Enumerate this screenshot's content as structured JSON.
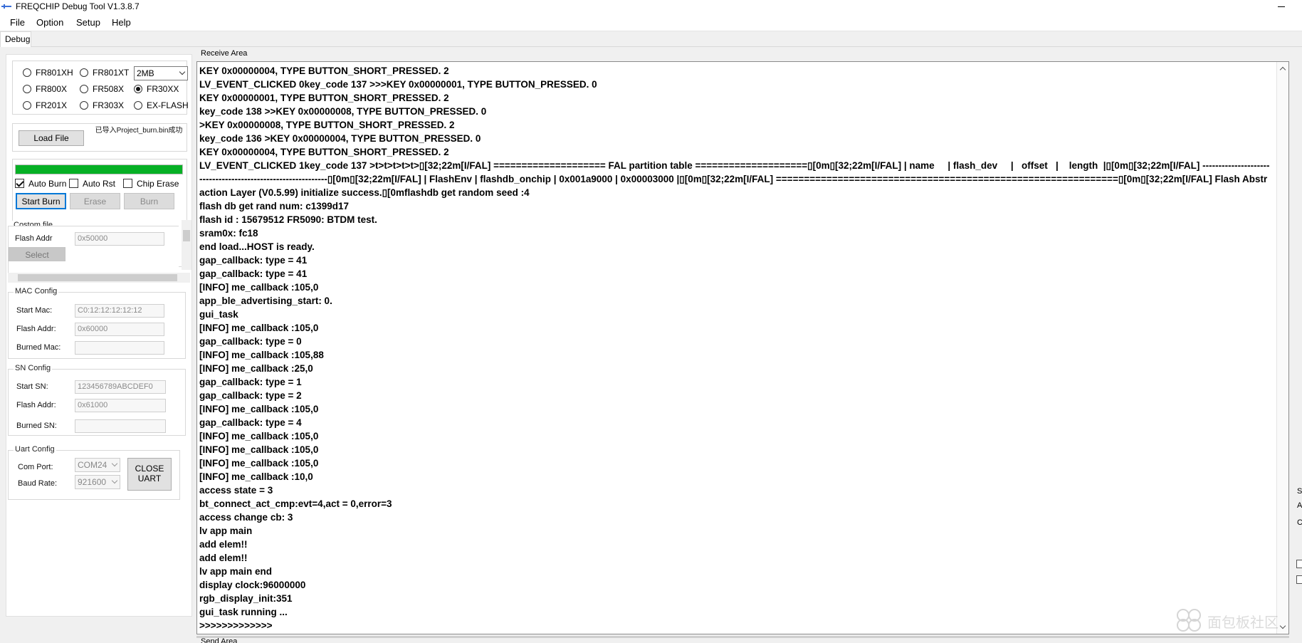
{
  "window": {
    "title": "FREQCHIP Debug Tool V1.3.8.7"
  },
  "menu": [
    "File",
    "Option",
    "Setup",
    "Help"
  ],
  "tabs": [
    "Debug"
  ],
  "chip": {
    "options": [
      "FR801XH",
      "FR801XT",
      "FR800X",
      "FR508X",
      "FR30XX",
      "FR201X",
      "FR303X",
      "EX-FLASH"
    ],
    "selected": "FR30XX",
    "flash_size": "2MB"
  },
  "load": {
    "button": "Load File",
    "status": "已导入Project_burn.bin成功"
  },
  "progress": {
    "value": 1.0,
    "color": "#06b025"
  },
  "burn_opts": {
    "auto_burn": "Auto Burn",
    "auto_rst": "Auto Rst",
    "chip_erase": "Chip Erase"
  },
  "burn_buttons": {
    "start": "Start Burn",
    "erase": "Erase",
    "burn": "Burn"
  },
  "custom_file": {
    "title": "Costom file",
    "flash_addr_label": "Flash Addr",
    "flash_addr_value": "0x50000",
    "select": "Select"
  },
  "mac": {
    "title": "MAC Config",
    "start_label": "Start Mac:",
    "start_value": "C0:12:12:12:12:12",
    "flash_label": "Flash Addr:",
    "flash_value": "0x60000",
    "burned_label": "Burned Mac:",
    "burned_value": ""
  },
  "sn": {
    "title": "SN Config",
    "start_label": "Start SN:",
    "start_value": "123456789ABCDEF0",
    "flash_label": "Flash Addr:",
    "flash_value": "0x61000",
    "burned_label": "Burned SN:",
    "burned_value": ""
  },
  "uart": {
    "title": "Uart Config",
    "port_label": "Com Port:",
    "port_value": "COM24",
    "baud_label": "Baud Rate:",
    "baud_value": "921600",
    "close": "CLOSE UART"
  },
  "receive": {
    "label": "Receive Area",
    "log": "KEY 0x00000004, TYPE BUTTON_SHORT_PRESSED. 2\nLV_EVENT_CLICKED 0key_code 137 >>>KEY 0x00000001, TYPE BUTTON_PRESSED. 0\nKEY 0x00000001, TYPE BUTTON_SHORT_PRESSED. 2\nkey_code 138 >>KEY 0x00000008, TYPE BUTTON_PRESSED. 0\n>KEY 0x00000008, TYPE BUTTON_SHORT_PRESSED. 2\nkey_code 136 >KEY 0x00000004, TYPE BUTTON_PRESSED. 0\nKEY 0x00000004, TYPE BUTTON_SHORT_PRESSED. 2\nLV_EVENT_CLICKED 1key_code 137 >t>t>t>t>t>▯[32;22m[I/FAL] ==================== FAL partition table ====================▯[0m▯[32;22m[I/FAL] | name     | flash_dev     |   offset   |    length  |▯[0m▯[32;22m[I/FAL] -------------------------------------------------------------▯[0m▯[32;22m[I/FAL] | FlashEnv | flashdb_onchip | 0x001a9000 | 0x00003000 |▯[0m▯[32;22m[I/FAL] =============================================================▯[0m▯[32;22m[I/FAL] Flash Abstraction Layer (V0.5.99) initialize success.▯[0mflashdb get random seed :4\nflash db get rand num: c1399d17\nflash id : 15679512 FR5090: BTDM test.\nsram0x: fc18\nend load...HOST is ready.\ngap_callback: type = 41\ngap_callback: type = 41\n[INFO] me_callback :105,0\napp_ble_advertising_start: 0.\ngui_task\n[INFO] me_callback :105,0\ngap_callback: type = 0\n[INFO] me_callback :105,88\n[INFO] me_callback :25,0\ngap_callback: type = 1\ngap_callback: type = 2\n[INFO] me_callback :105,0\ngap_callback: type = 4\n[INFO] me_callback :105,0\n[INFO] me_callback :105,0\n[INFO] me_callback :105,0\n[INFO] me_callback :10,0\naccess state = 3\nbt_connect_act_cmp:evt=4,act = 0,error=3\naccess change cb: 3\nlv app main\nadd elem!!\nadd elem!!\nlv app main end\ndisplay clock:96000000\nrgb_display_init:351\ngui_task running ...\n>>>>>>>>>>>>>"
  },
  "send": {
    "label": "Send Area"
  },
  "watermark": "面包板社区"
}
